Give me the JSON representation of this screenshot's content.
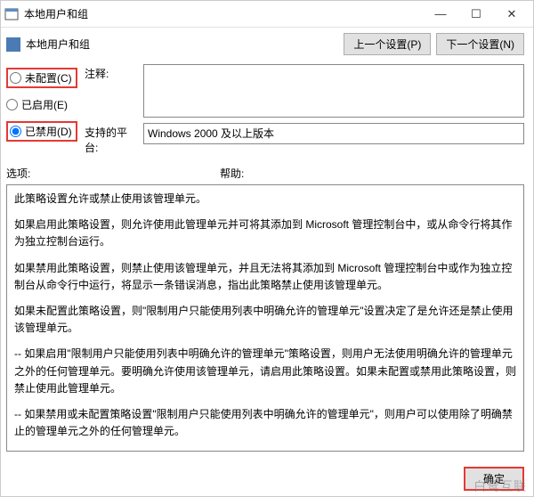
{
  "window": {
    "title": "本地用户和组"
  },
  "header": {
    "title": "本地用户和组",
    "prev_button": "上一个设置(P)",
    "next_button": "下一个设置(N)"
  },
  "radios": {
    "not_configured": "未配置(C)",
    "enabled": "已启用(E)",
    "disabled": "已禁用(D)",
    "selected": "disabled"
  },
  "fields": {
    "comment_label": "注释:",
    "comment_value": "",
    "platform_label": "支持的平台:",
    "platform_value": "Windows 2000 及以上版本"
  },
  "sections": {
    "options_label": "选项:",
    "help_label": "帮助:"
  },
  "help_text": {
    "p1": "此策略设置允许或禁止使用该管理单元。",
    "p2": "如果启用此策略设置，则允许使用此管理单元并可将其添加到 Microsoft 管理控制台中，或从命令行将其作为独立控制台运行。",
    "p3": "如果禁用此策略设置，则禁止使用该管理单元，并且无法将其添加到 Microsoft 管理控制台中或作为独立控制台从命令行中运行，将显示一条错误消息，指出此策略禁止使用该管理单元。",
    "p4": "如果未配置此策略设置，则\"限制用户只能使用列表中明确允许的管理单元\"设置决定了是允许还是禁止使用该管理单元。",
    "p5": "-- 如果启用\"限制用户只能使用列表中明确允许的管理单元\"策略设置，则用户无法使用明确允许的管理单元之外的任何管理单元。要明确允许使用该管理单元，请启用此策略设置。如果未配置或禁用此策略设置，则禁止使用此管理单元。",
    "p6": "-- 如果禁用或未配置策略设置\"限制用户只能使用列表中明确允许的管理单元\"，则用户可以使用除了明确禁止的管理单元之外的任何管理单元。"
  },
  "footer": {
    "ok": "确定"
  },
  "watermark": "白鹭互联"
}
